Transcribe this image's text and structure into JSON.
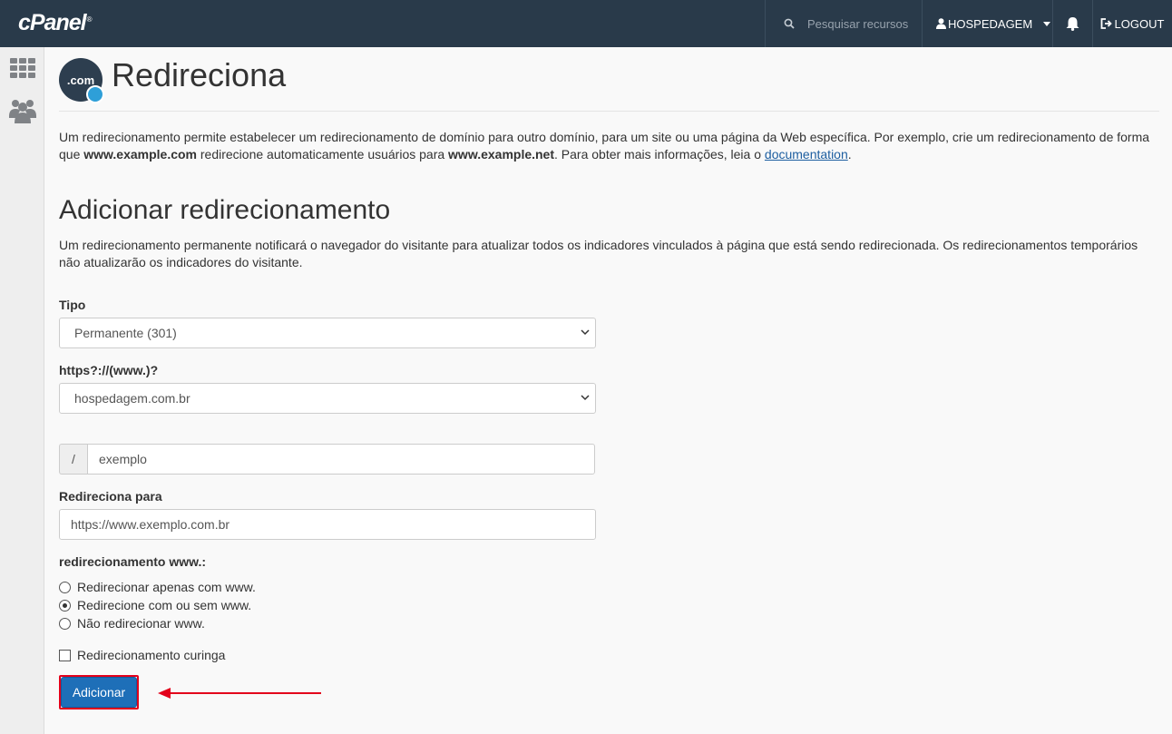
{
  "topbar": {
    "logo": "cPanel",
    "logo_mark": "®",
    "search_placeholder": "Pesquisar recursos",
    "user": "HOSPEDAGEM",
    "logout": "LOGOUT"
  },
  "sidebar": {
    "items": [
      {
        "icon": "grid-icon"
      },
      {
        "icon": "users-icon"
      }
    ]
  },
  "page": {
    "icon_text": ".com",
    "title": "Redireciona",
    "intro_part1": "Um redirecionamento permite estabelecer um redirecionamento de domínio para outro domínio, para um site ou uma página da Web específica. Por exemplo, crie um redirecionamento de forma que ",
    "intro_bold1": "www.example.com",
    "intro_part2": " redirecione automaticamente usuários para ",
    "intro_bold2": "www.example.net",
    "intro_part3": ". Para obter mais informações, leia o ",
    "intro_link": "documentation",
    "intro_end": "."
  },
  "form": {
    "section_title": "Adicionar redirecionamento",
    "section_desc": "Um redirecionamento permanente notificará o navegador do visitante para atualizar todos os indicadores vinculados à página que está sendo redirecionada. Os redirecionamentos temporários não atualizarão os indicadores do visitante.",
    "type_label": "Tipo",
    "type_value": "Permanente (301)",
    "domain_label": "https?://(www.)?",
    "domain_value": "hospedagem.com.br",
    "path_prefix": "/",
    "path_value": "exemplo",
    "redirect_label": "Redireciona para",
    "redirect_value": "https://www.exemplo.com.br",
    "www_label": "redirecionamento www.:",
    "www_options": [
      {
        "label": "Redirecionar apenas com www.",
        "checked": false
      },
      {
        "label": "Redirecione com ou sem www.",
        "checked": true
      },
      {
        "label": "Não redirecionar www.",
        "checked": false
      }
    ],
    "wildcard_label": "Redirecionamento curinga",
    "wildcard_checked": false,
    "submit_label": "Adicionar"
  },
  "colors": {
    "topbar": "#293a4a",
    "button": "#1e6fb8",
    "highlight": "#e3001b",
    "link": "#1d5ea0"
  }
}
